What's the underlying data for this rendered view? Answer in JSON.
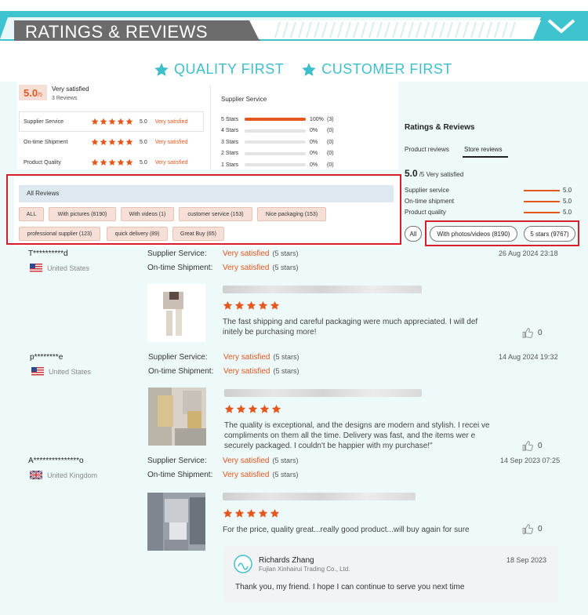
{
  "banner": {
    "title": "RATINGS & REVIEWS"
  },
  "slogan": {
    "left": "QUALITY FIRST",
    "right": "CUSTOMER FIRST"
  },
  "summary": {
    "score": "5.0",
    "score_suffix": "/5",
    "satisfaction": "Very satisfied",
    "review_count": "3 Reviews"
  },
  "summary_metrics": [
    {
      "label": "Supplier Service",
      "score": "5.0",
      "status": "Very satisfied"
    },
    {
      "label": "On-time Shipment",
      "score": "5.0",
      "status": "Very satisfied"
    },
    {
      "label": "Product Quality",
      "score": "5.0",
      "status": "Very satisfied"
    }
  ],
  "distribution": {
    "title": "Supplier Service",
    "rows": [
      {
        "label": "5 Stars",
        "pct": "100%",
        "count": "(3)",
        "fill": 1.0
      },
      {
        "label": "4 Stars",
        "pct": "0%",
        "count": "(0)",
        "fill": 0
      },
      {
        "label": "3 Stars",
        "pct": "0%",
        "count": "(0)",
        "fill": 0
      },
      {
        "label": "2 Stars",
        "pct": "0%",
        "count": "(0)",
        "fill": 0
      },
      {
        "label": "1 Stars",
        "pct": "0%",
        "count": "(0)",
        "fill": 0
      }
    ]
  },
  "all_reviews": {
    "title": "All Reviews",
    "chips": [
      "ALL",
      "With pictures (8190)",
      "With videos (1)",
      "customer service (153)",
      "Nice packaging (153)",
      "professional supplier (123)",
      "quick delivery (89)",
      "Great Buy (65)"
    ]
  },
  "side": {
    "title": "Ratings & Reviews",
    "tab_product": "Product reviews",
    "tab_store": "Store reviews",
    "score": "5.0",
    "score_suffix": "/5 Very satisfied",
    "metrics": [
      {
        "label": "Supplier service",
        "value": "5.0"
      },
      {
        "label": "On-time shipment",
        "value": "5.0"
      },
      {
        "label": "Product quality",
        "value": "5.0"
      }
    ],
    "filters": {
      "all": "All",
      "photos": "With photos/videos (8190)",
      "stars": "5 stars (9767)"
    }
  },
  "reviews": [
    {
      "user": "T**********d",
      "country": "United States",
      "l1": "Supplier Service:",
      "v1": "Very satisfied",
      "s1": "(5 stars)",
      "l2": "On-time Shipment:",
      "v2": "Very satisfied",
      "s2": "(5 stars)",
      "date": "26 Aug 2024 23:18",
      "text": "The fast shipping and careful packaging were much appreciated. I will def initely be purchasing more!",
      "likes": "0"
    },
    {
      "user": "p********e",
      "country": "United States",
      "l1": "Supplier Service:",
      "v1": "Very satisfied",
      "s1": "(5 stars)",
      "l2": "On-time Shipment:",
      "v2": "Very satisfied",
      "s2": "(5 stars)",
      "date": "14 Aug 2024 19:32",
      "text": "The quality is exceptional, and the designs are modern and stylish. I recei ve compliments on them all the time. Delivery was fast, and the items wer e securely packaged. I couldn't be happier with my purchase!\"",
      "likes": "0"
    },
    {
      "user": "A***************o",
      "country": "United Kingdom",
      "l1": "Supplier Service:",
      "v1": "Very satisfied",
      "s1": "(5 stars)",
      "l2": "On-time Shipment:",
      "v2": "Very satisfied",
      "s2": "(5 stars)",
      "date": "14 Sep 2023 07:25",
      "text": "For the price, quality great...really good product...will buy again for sure",
      "likes": "0"
    }
  ],
  "reply": {
    "name": "Richards Zhang",
    "company": "Fujian Xinhairui Trading Co., Ltd.",
    "date": "18 Sep 2023",
    "text": "Thank you, my friend. I hope I can continue to serve you next time"
  },
  "colors": {
    "accent": "#e4571d",
    "teal": "#3fbfcc",
    "highlight": "#d81e2a"
  }
}
